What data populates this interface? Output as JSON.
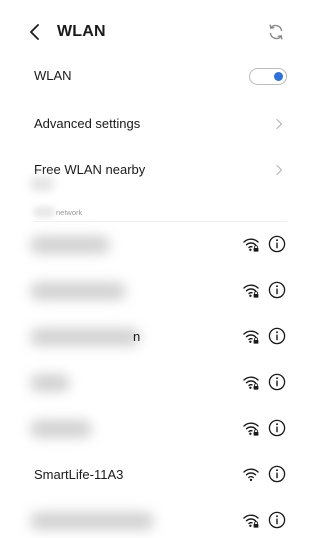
{
  "header": {
    "title": "WLAN",
    "back_icon": "chevron-left-icon",
    "refresh_icon": "refresh-icon"
  },
  "wlan": {
    "label": "WLAN",
    "enabled": true,
    "accent": "#2f6fd6"
  },
  "advanced": {
    "label": "Advanced settings"
  },
  "free_wlan": {
    "label": "Free WLAN nearby"
  },
  "section": {
    "label": "network"
  },
  "networks": [
    {
      "name": "",
      "secured": true
    },
    {
      "name": "",
      "secured": true
    },
    {
      "name": "n",
      "secured": true
    },
    {
      "name": "",
      "secured": true
    },
    {
      "name": "",
      "secured": true
    },
    {
      "name": "SmartLife-11A3",
      "secured": false
    },
    {
      "name": "",
      "secured": true
    }
  ]
}
